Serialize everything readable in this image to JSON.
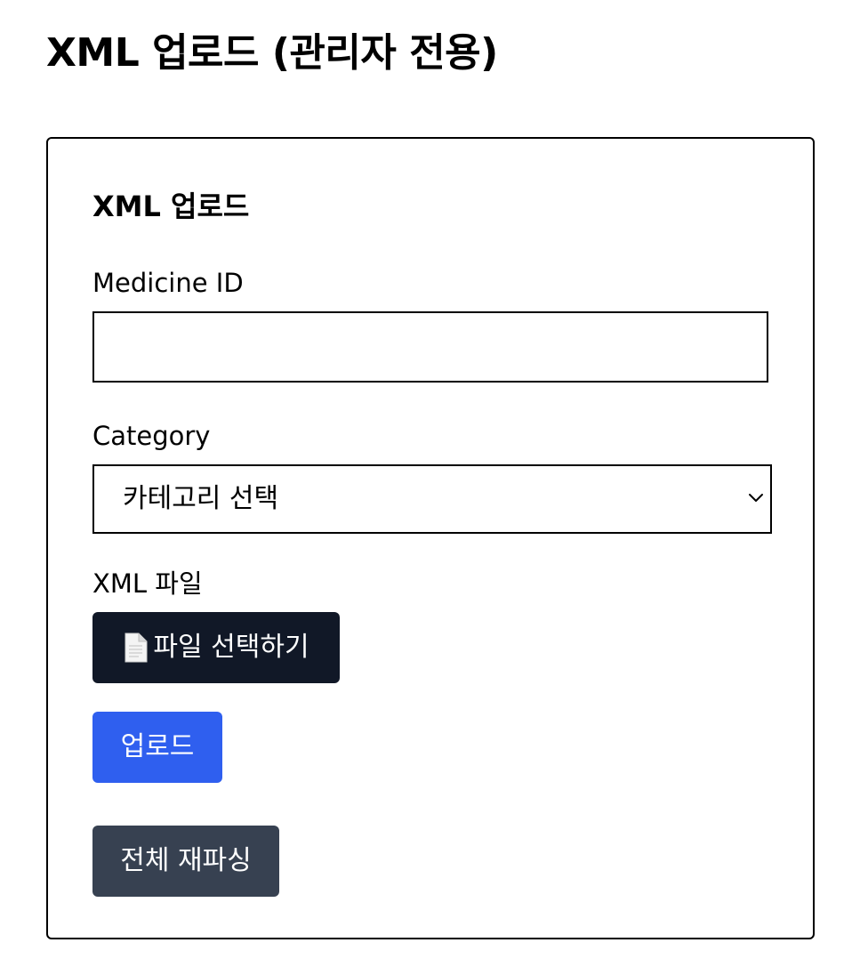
{
  "page": {
    "title": "XML 업로드 (관리자 전용)"
  },
  "card": {
    "title": "XML 업로드"
  },
  "form": {
    "medicine_id": {
      "label": "Medicine ID",
      "value": "",
      "placeholder": ""
    },
    "category": {
      "label": "Category",
      "selected": "카테고리 선택",
      "icon": "chevron-down-icon"
    },
    "xml_file": {
      "label": "XML 파일",
      "button_label": "파일 선택하기",
      "button_icon": "document-icon"
    }
  },
  "actions": {
    "upload_label": "업로드",
    "reparse_label": "전체 재파싱"
  },
  "colors": {
    "file_button_bg": "#111827",
    "upload_button_bg": "#2f5fef",
    "reparse_button_bg": "#374151",
    "border": "#000000"
  }
}
